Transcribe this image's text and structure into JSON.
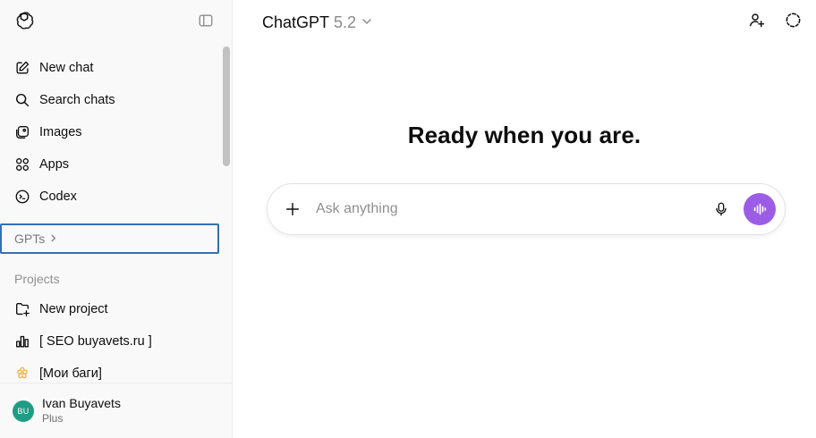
{
  "sidebar": {
    "logo_icon": "openai-logo-icon",
    "toggle_icon": "sidebar-toggle-icon",
    "nav": [
      {
        "label": "New chat",
        "icon": "new-chat-icon"
      },
      {
        "label": "Search chats",
        "icon": "search-icon"
      },
      {
        "label": "Images",
        "icon": "images-icon"
      },
      {
        "label": "Apps",
        "icon": "apps-icon"
      },
      {
        "label": "Codex",
        "icon": "codex-icon"
      }
    ],
    "gpts_label": "GPTs",
    "projects_label": "Projects",
    "projects": [
      {
        "label": "New project",
        "icon": "new-folder-icon"
      },
      {
        "label": "[ SEO buyavets.ru ]",
        "icon": "bar-chart-icon"
      },
      {
        "label": "[Мои баги]",
        "icon": "flower-icon",
        "icon_color": "#f2b33d"
      }
    ],
    "user": {
      "initials": "BU",
      "name": "Ivan Buyavets",
      "plan": "Plus",
      "avatar_color": "#1f9d84"
    }
  },
  "header": {
    "model_name": "ChatGPT",
    "model_version": "5.2"
  },
  "main": {
    "headline": "Ready when you are.",
    "composer": {
      "placeholder": "Ask anything",
      "voice_button_color": "#9b5de5"
    }
  },
  "colors": {
    "focus_border": "#3270b6",
    "sidebar_bg": "#f9f9f9"
  }
}
